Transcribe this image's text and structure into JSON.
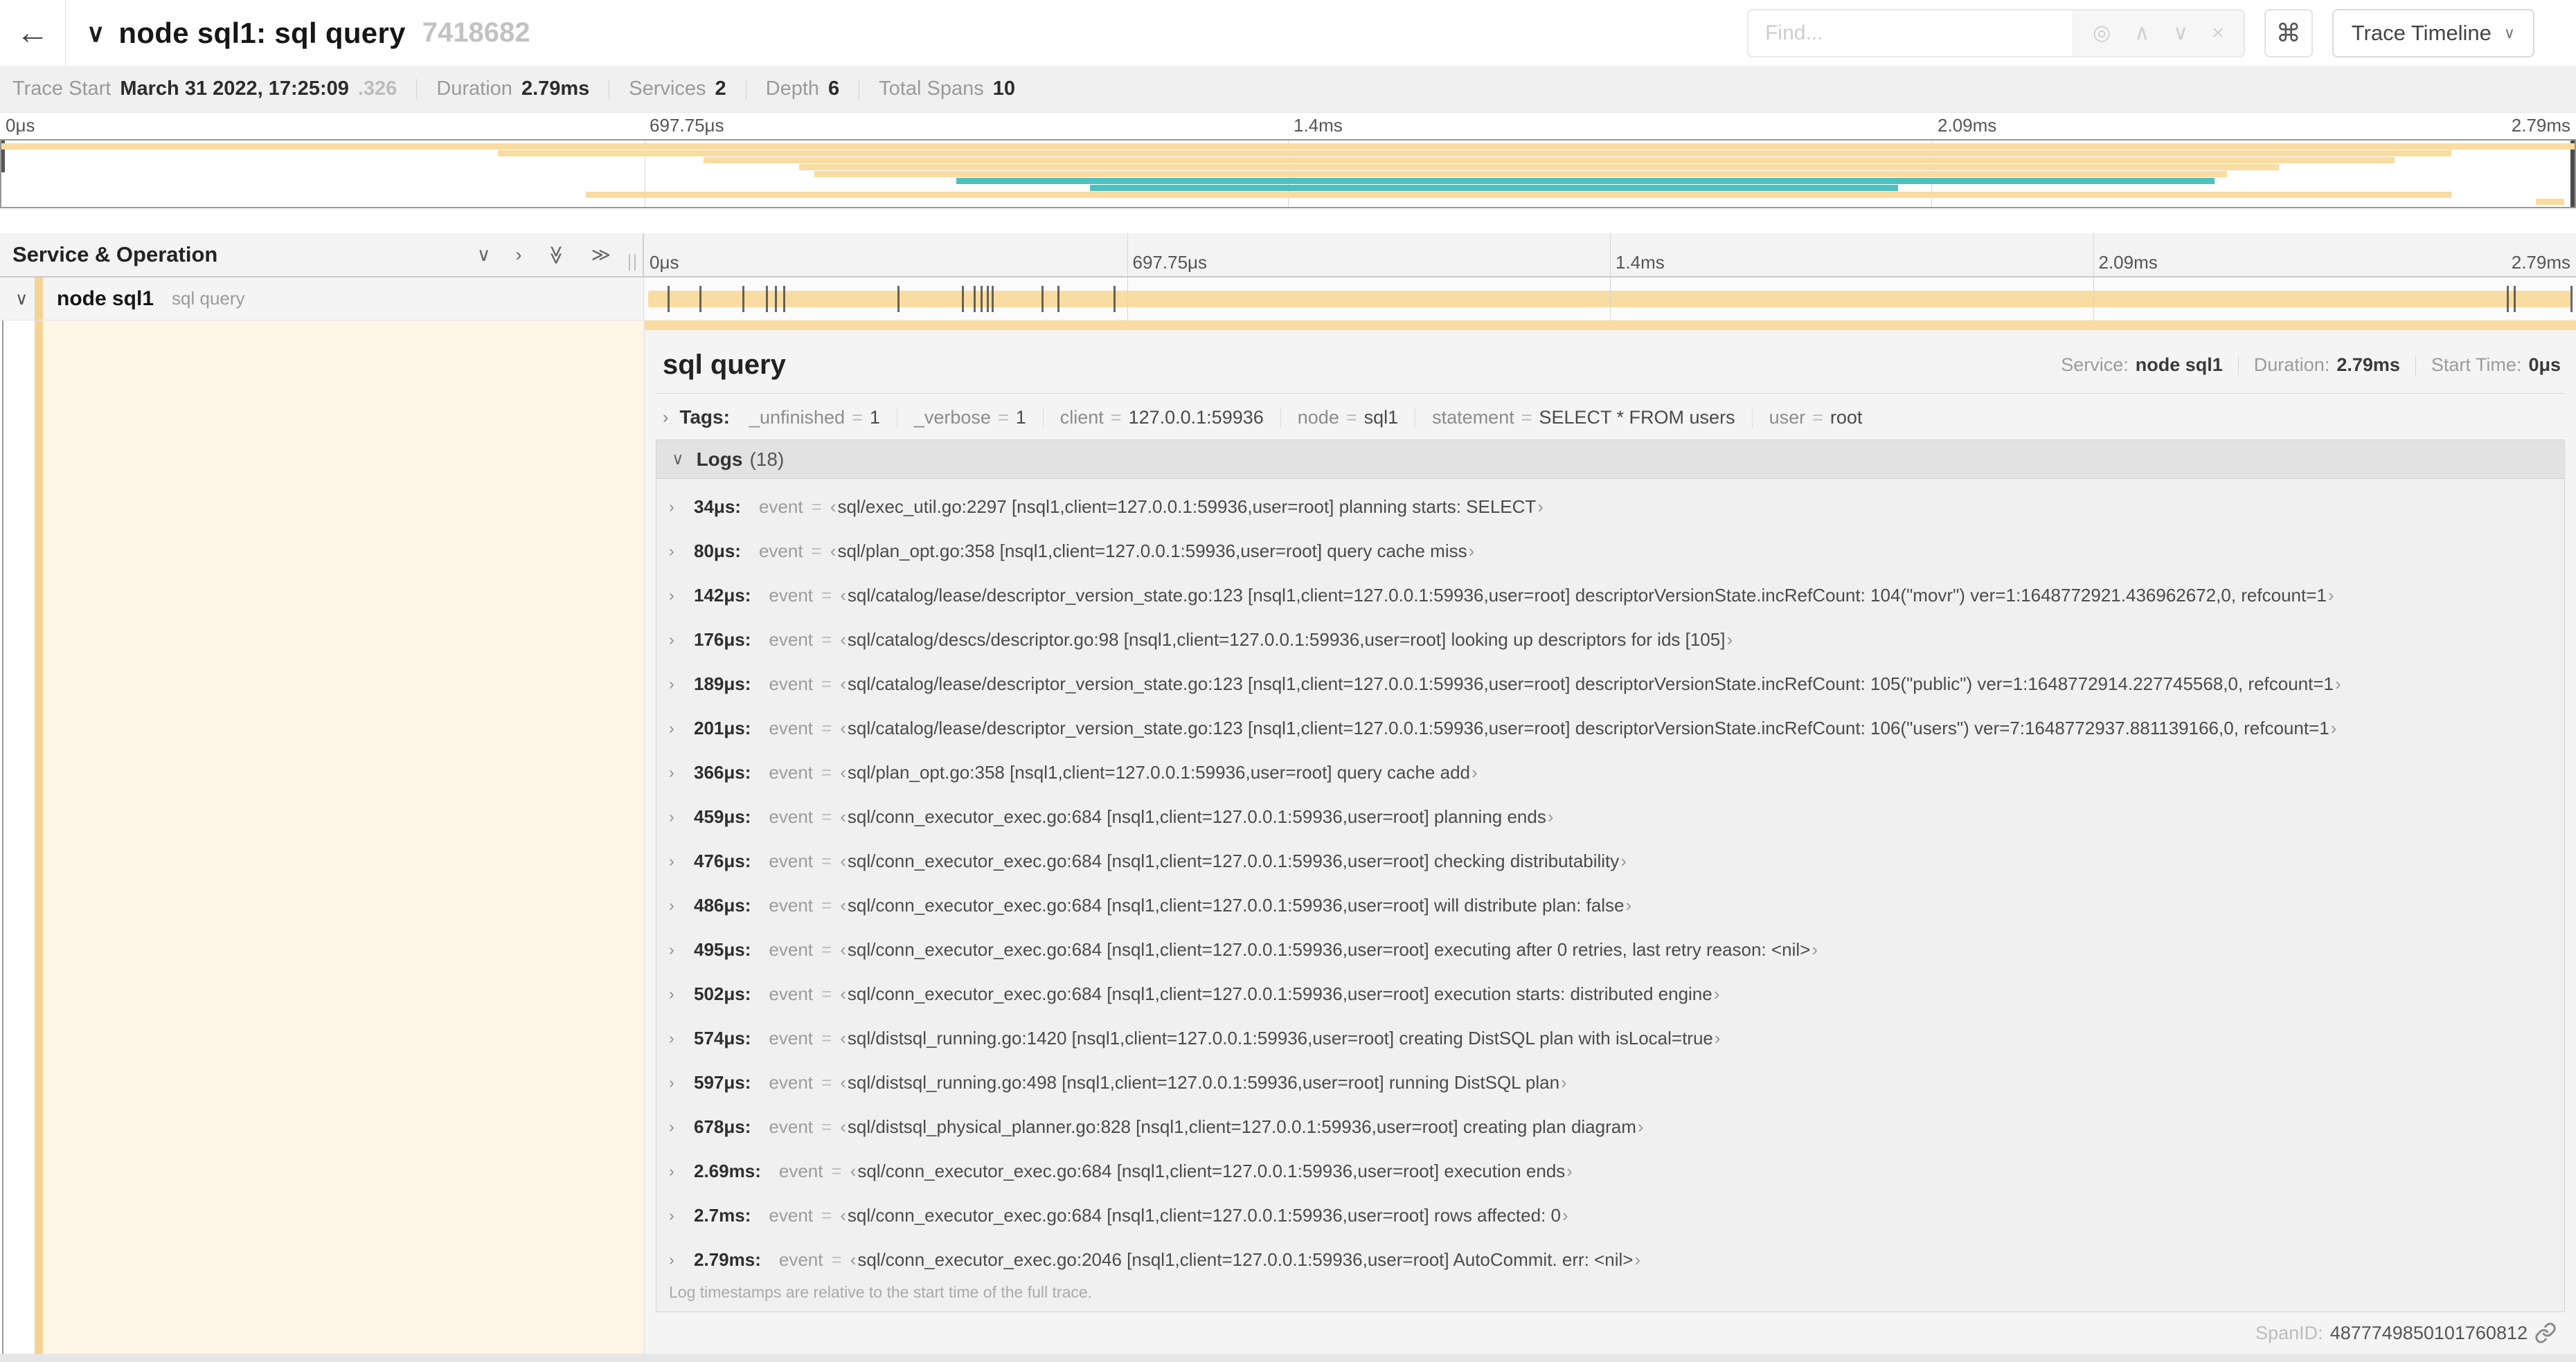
{
  "icons": {
    "back": "←",
    "caret_down": "∨",
    "chevron_right": "›",
    "double_chevron": "≫",
    "locate": "◎",
    "up": "∧",
    "down": "∨",
    "close": "×",
    "command": "⌘"
  },
  "header": {
    "title": "node sql1: sql query",
    "trace_id": "7418682",
    "find_placeholder": "Find...",
    "view_selector": "Trace Timeline"
  },
  "trace_meta": [
    {
      "label": "Trace Start",
      "value": "March 31 2022, 17:25:09",
      "muted": ".326"
    },
    {
      "label": "Duration",
      "value": "2.79ms"
    },
    {
      "label": "Services",
      "value": "2"
    },
    {
      "label": "Depth",
      "value": "6"
    },
    {
      "label": "Total Spans",
      "value": "10"
    }
  ],
  "timeline": {
    "ruler_labels": [
      "0μs",
      "697.75μs",
      "1.4ms",
      "2.09ms",
      "2.79ms"
    ],
    "duration_us": 2790,
    "colors": {
      "tan": "#f8dca2",
      "teal": "#4bc1c1",
      "stripe": "#f3d493"
    },
    "minimap_spans": [
      {
        "start": 0,
        "end": 1.0,
        "color": "tan"
      },
      {
        "start": 0.193,
        "end": 0.952,
        "color": "tan"
      },
      {
        "start": 0.273,
        "end": 0.93,
        "color": "tan"
      },
      {
        "start": 0.31,
        "end": 0.885,
        "color": "tan"
      },
      {
        "start": 0.316,
        "end": 0.865,
        "color": "tan"
      },
      {
        "start": 0.371,
        "end": 0.86,
        "color": "teal"
      },
      {
        "start": 0.423,
        "end": 0.737,
        "color": "teal"
      },
      {
        "start": 0.227,
        "end": 0.952,
        "color": "tan"
      },
      {
        "start": 0.985,
        "end": 0.996,
        "color": "tan"
      }
    ]
  },
  "span_table": {
    "header": "Service & Operation",
    "row": {
      "service": "node sql1",
      "operation": "sql query"
    }
  },
  "detail": {
    "title": "sql query",
    "meta": [
      {
        "label": "Service:",
        "value": "node sql1"
      },
      {
        "label": "Duration:",
        "value": "2.79ms"
      },
      {
        "label": "Start Time:",
        "value": "0μs"
      }
    ],
    "tags_label": "Tags:",
    "eq": "=",
    "tags": [
      {
        "key": "_unfinished",
        "value": "1"
      },
      {
        "key": "_verbose",
        "value": "1"
      },
      {
        "key": "client",
        "value": "127.0.0.1:59936"
      },
      {
        "key": "node",
        "value": "sql1"
      },
      {
        "key": "statement",
        "value": "SELECT * FROM users"
      },
      {
        "key": "user",
        "value": "root"
      }
    ],
    "logs": {
      "label": "Logs",
      "count": "(18)",
      "field": "event",
      "entries": [
        {
          "time": "34μs",
          "t_us": 34,
          "value": "sql/exec_util.go:2297 [nsql1,client=127.0.0.1:59936,user=root] planning starts: SELECT"
        },
        {
          "time": "80μs",
          "t_us": 80,
          "value": "sql/plan_opt.go:358 [nsql1,client=127.0.0.1:59936,user=root] query cache miss"
        },
        {
          "time": "142μs",
          "t_us": 142,
          "value": "sql/catalog/lease/descriptor_version_state.go:123 [nsql1,client=127.0.0.1:59936,user=root] descriptorVersionState.incRefCount: 104(\"movr\") ver=1:1648772921.436962672,0, refcount=1"
        },
        {
          "time": "176μs",
          "t_us": 176,
          "value": "sql/catalog/descs/descriptor.go:98 [nsql1,client=127.0.0.1:59936,user=root] looking up descriptors for ids [105]"
        },
        {
          "time": "189μs",
          "t_us": 189,
          "value": "sql/catalog/lease/descriptor_version_state.go:123 [nsql1,client=127.0.0.1:59936,user=root] descriptorVersionState.incRefCount: 105(\"public\") ver=1:1648772914.227745568,0, refcount=1"
        },
        {
          "time": "201μs",
          "t_us": 201,
          "value": "sql/catalog/lease/descriptor_version_state.go:123 [nsql1,client=127.0.0.1:59936,user=root] descriptorVersionState.incRefCount: 106(\"users\") ver=7:1648772937.881139166,0, refcount=1"
        },
        {
          "time": "366μs",
          "t_us": 366,
          "value": "sql/plan_opt.go:358 [nsql1,client=127.0.0.1:59936,user=root] query cache add"
        },
        {
          "time": "459μs",
          "t_us": 459,
          "value": "sql/conn_executor_exec.go:684 [nsql1,client=127.0.0.1:59936,user=root] planning ends"
        },
        {
          "time": "476μs",
          "t_us": 476,
          "value": "sql/conn_executor_exec.go:684 [nsql1,client=127.0.0.1:59936,user=root] checking distributability"
        },
        {
          "time": "486μs",
          "t_us": 486,
          "value": "sql/conn_executor_exec.go:684 [nsql1,client=127.0.0.1:59936,user=root] will distribute plan: false"
        },
        {
          "time": "495μs",
          "t_us": 495,
          "value": "sql/conn_executor_exec.go:684 [nsql1,client=127.0.0.1:59936,user=root] executing after 0 retries, last retry reason: <nil>"
        },
        {
          "time": "502μs",
          "t_us": 502,
          "value": "sql/conn_executor_exec.go:684 [nsql1,client=127.0.0.1:59936,user=root] execution starts: distributed engine"
        },
        {
          "time": "574μs",
          "t_us": 574,
          "value": "sql/distsql_running.go:1420 [nsql1,client=127.0.0.1:59936,user=root] creating DistSQL plan with isLocal=true"
        },
        {
          "time": "597μs",
          "t_us": 597,
          "value": "sql/distsql_running.go:498 [nsql1,client=127.0.0.1:59936,user=root] running DistSQL plan"
        },
        {
          "time": "678μs",
          "t_us": 678,
          "value": "sql/distsql_physical_planner.go:828 [nsql1,client=127.0.0.1:59936,user=root] creating plan diagram"
        },
        {
          "time": "2.69ms",
          "t_us": 2690,
          "value": "sql/conn_executor_exec.go:684 [nsql1,client=127.0.0.1:59936,user=root] execution ends"
        },
        {
          "time": "2.7ms",
          "t_us": 2700,
          "value": "sql/conn_executor_exec.go:684 [nsql1,client=127.0.0.1:59936,user=root] rows affected: 0"
        },
        {
          "time": "2.79ms",
          "t_us": 2790,
          "value": "sql/conn_executor_exec.go:2046 [nsql1,client=127.0.0.1:59936,user=root] AutoCommit. err: <nil>"
        }
      ],
      "note": "Log timestamps are relative to the start time of the full trace."
    },
    "span_id_label": "SpanID:",
    "span_id": "4877749850101760812"
  }
}
